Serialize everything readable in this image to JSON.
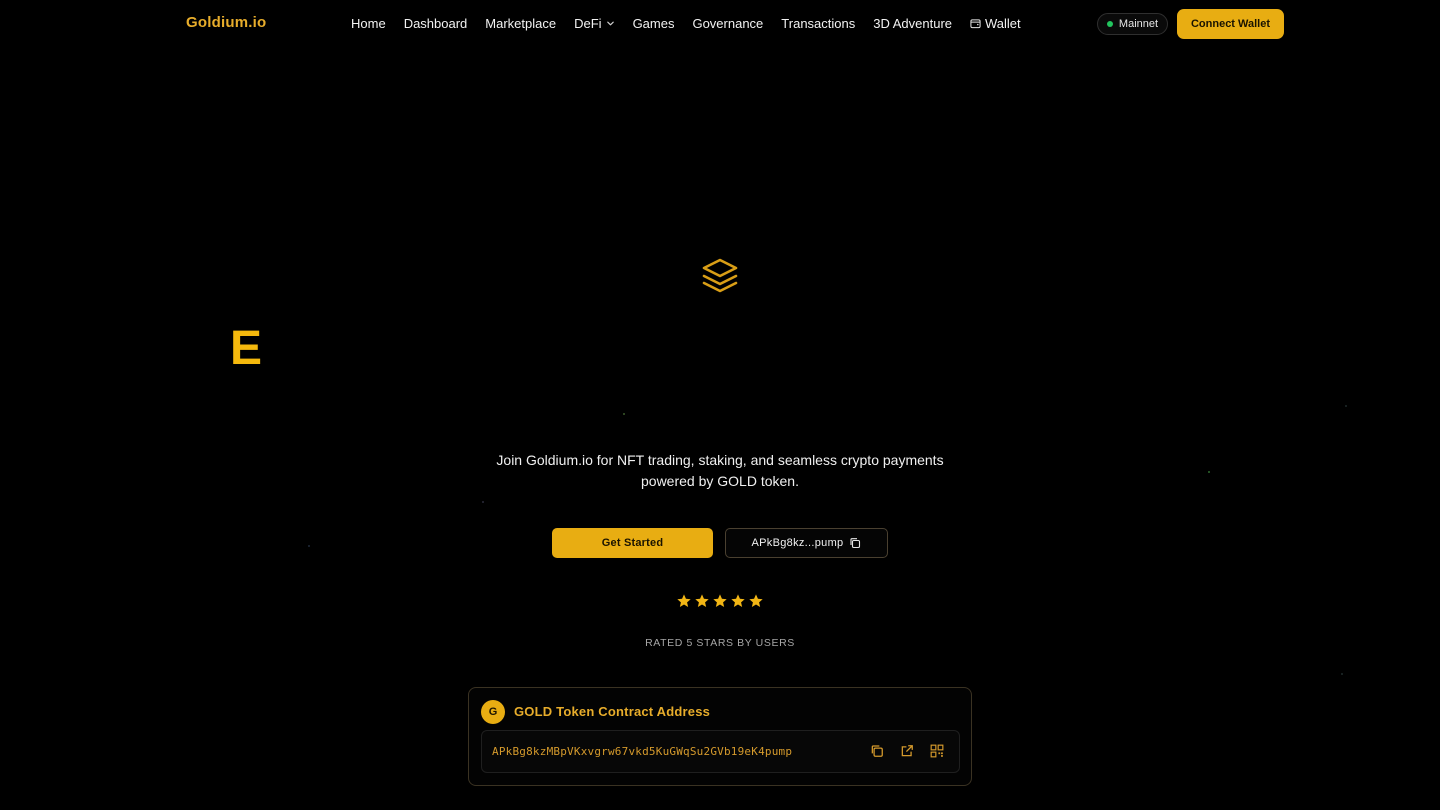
{
  "navbar": {
    "logo": "Goldium.io",
    "links": [
      {
        "label": "Home"
      },
      {
        "label": "Dashboard"
      },
      {
        "label": "Marketplace"
      },
      {
        "label": "DeFi",
        "icon": "chevron-down-icon"
      },
      {
        "label": "Games"
      },
      {
        "label": "Governance"
      },
      {
        "label": "Transactions"
      },
      {
        "label": "3D Adventure"
      },
      {
        "label": "Wallet",
        "icon": "wallet-icon"
      }
    ],
    "network": "Mainnet",
    "network_status_color": "#22c55e",
    "connect_label": "Connect Wallet"
  },
  "hero": {
    "icon": "layers-icon",
    "letter": "E",
    "tagline_line1": "Join Goldium.io for NFT trading, staking, and seamless crypto payments",
    "tagline_line2": "powered by GOLD token.",
    "cta_label": "Get Started",
    "short_address": "APkBg8kz...pump",
    "copy_icon": "copy-icon",
    "rating_stars": 5,
    "rating_label": "RATED 5 STARS BY USERS"
  },
  "contract": {
    "badge": "G",
    "title": "GOLD Token Contract Address",
    "address": "APkBg8kzMBpVKxvgrw67vkd5KuGWqSu2GVb19eK4pump",
    "actions": [
      "copy-icon",
      "external-link-icon",
      "qr-code-icon"
    ]
  },
  "colors": {
    "accent": "#e8ad12",
    "accent_text": "#e8ad2b",
    "background": "#000000"
  }
}
